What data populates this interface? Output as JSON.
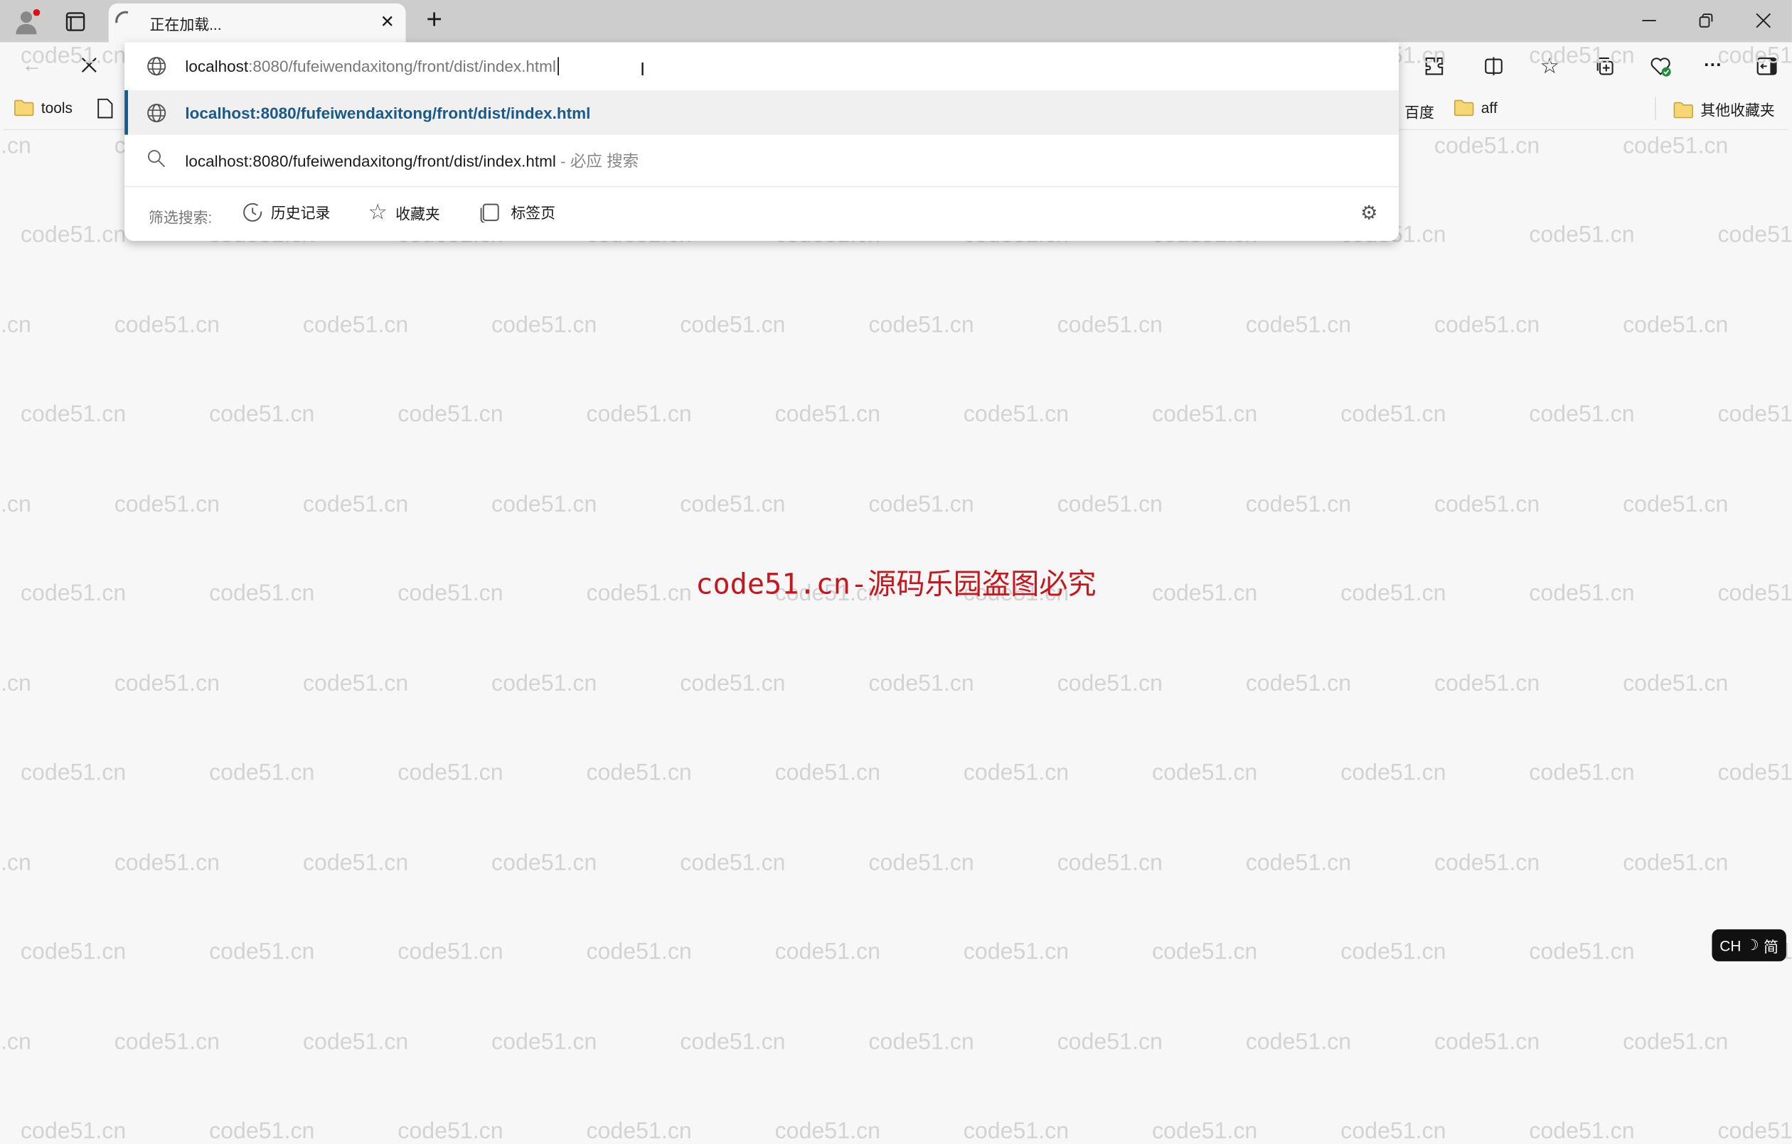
{
  "watermark": "code51.cn",
  "watermark_notice": "code51.cn-源码乐园盗图必究",
  "tab": {
    "title": "正在加载..."
  },
  "address": {
    "host": "localhost",
    "rest": ":8080/fufeiwendaxitong/front/dist/index.html"
  },
  "suggestions": [
    {
      "icon": "globe-icon",
      "text": "localhost:8080/fufeiwendaxitong/front/dist/index.html"
    },
    {
      "icon": "search-icon",
      "text": "localhost:8080/fufeiwendaxitong/front/dist/index.html",
      "suffix": " - 必应 搜索"
    }
  ],
  "filter": {
    "label": "筛选搜索:",
    "items": [
      {
        "icon": "history-icon",
        "label": "历史记录"
      },
      {
        "icon": "star-icon",
        "label": "收藏夹"
      },
      {
        "icon": "tabs-icon",
        "label": "标签页"
      }
    ]
  },
  "bookmarks": {
    "left": [
      {
        "label": "tools"
      }
    ],
    "right": [
      {
        "label": "百度"
      },
      {
        "label": "aff"
      }
    ],
    "other": "其他收藏夹"
  },
  "ime": {
    "lang": "CH",
    "mode": "简"
  },
  "colors": {
    "accent": "#1a5a8a",
    "watermark_red": "#c8161d"
  }
}
